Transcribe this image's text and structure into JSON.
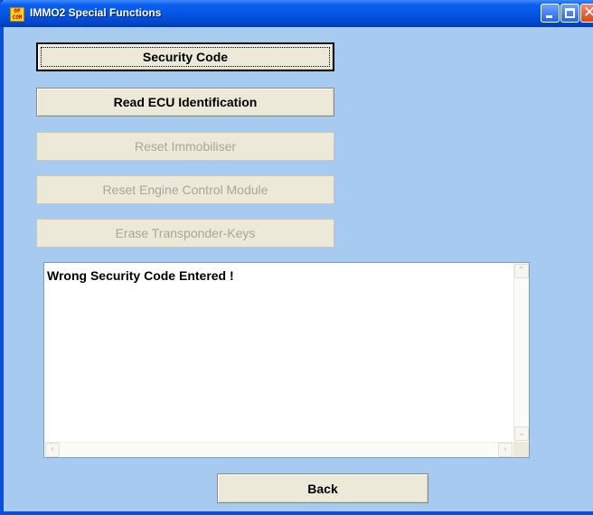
{
  "window": {
    "title": "IMMO2 Special Functions",
    "app_icon_text": "OP\nCOM"
  },
  "buttons": {
    "security_code": "Security Code",
    "read_ecu": "Read ECU Identification",
    "reset_immobiliser": "Reset Immobiliser",
    "reset_ecm": "Reset Engine Control Module",
    "erase_keys": "Erase Transponder-Keys",
    "back": "Back"
  },
  "output": {
    "text": "Wrong Security Code Entered !"
  },
  "icons": {
    "app": "opcom-app-icon",
    "minimize": "minimize-icon",
    "maximize": "maximize-icon",
    "close": "close-icon"
  },
  "colors": {
    "window_bg": "#a6caf0",
    "titlebar": "#0454e3",
    "button_face": "#ece9d8",
    "disabled_text": "#a8a69a"
  }
}
